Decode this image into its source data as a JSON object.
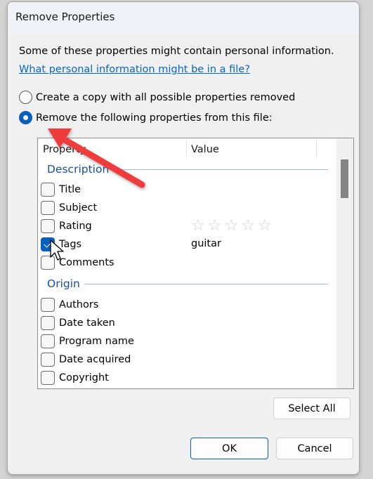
{
  "dialog": {
    "title": "Remove Properties",
    "intro_text": "Some of these properties might contain personal information.",
    "help_link": "What personal information might be in a file?"
  },
  "options": [
    {
      "label": "Create a copy with all possible properties removed",
      "selected": false
    },
    {
      "label": "Remove the following properties from this file:",
      "selected": true
    }
  ],
  "property_list": {
    "columns": [
      "Property",
      "Value"
    ],
    "groups": [
      {
        "name": "Description",
        "items": [
          {
            "label": "Title",
            "checked": false,
            "value": ""
          },
          {
            "label": "Subject",
            "checked": false,
            "value": ""
          },
          {
            "label": "Rating",
            "checked": false,
            "value": "",
            "rating_stars": 0,
            "rating_max": 5
          },
          {
            "label": "Tags",
            "checked": true,
            "value": "guitar"
          },
          {
            "label": "Comments",
            "checked": false,
            "value": ""
          }
        ]
      },
      {
        "name": "Origin",
        "items": [
          {
            "label": "Authors",
            "checked": false,
            "value": ""
          },
          {
            "label": "Date taken",
            "checked": false,
            "value": ""
          },
          {
            "label": "Program name",
            "checked": false,
            "value": ""
          },
          {
            "label": "Date acquired",
            "checked": false,
            "value": ""
          },
          {
            "label": "Copyright",
            "checked": false,
            "value": ""
          }
        ]
      }
    ],
    "star_glyph": "☆"
  },
  "buttons": {
    "select_all": "Select All",
    "ok": "OK",
    "cancel": "Cancel"
  },
  "colors": {
    "accent": "#0a5fbd",
    "link": "#0a64c8",
    "group_header": "#1a4ea1",
    "annotation_arrow": "#ee3b3b"
  }
}
